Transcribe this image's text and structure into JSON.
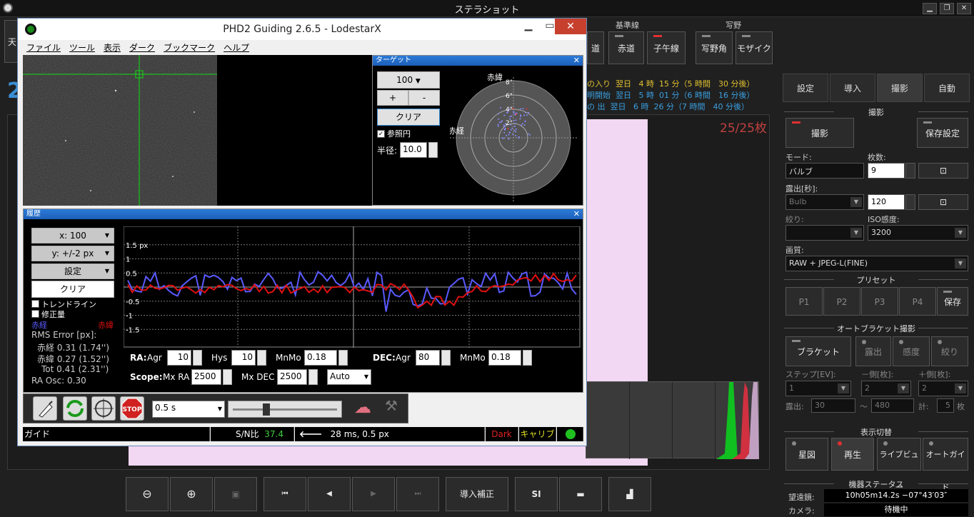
{
  "app_title": "ステラショット",
  "toolbar_groups": {
    "baseline": "基準線",
    "field": "写野"
  },
  "top_buttons": {
    "left_cut": "天",
    "road": "道",
    "equator": "赤道",
    "meridian": "子午線",
    "field_angle": "写野角",
    "mosaic": "モザイク"
  },
  "left_big_number": "2",
  "events": [
    {
      "name": "の入り",
      "day": "翌日",
      "h": "4 時",
      "m": "15 分",
      "rel": "5 時間　30 分後"
    },
    {
      "name": "明開始",
      "day": "翌日",
      "h": "5 時",
      "m": "01 分",
      "rel": "6 時間　16 分後"
    },
    {
      "name": "の 出",
      "day": "翌日",
      "h": "6 時",
      "m": "26 分",
      "rel": "7 時間　40 分後"
    }
  ],
  "frame_count": "25/25枚",
  "tabs": [
    "設定",
    "導入",
    "撮影",
    "自動"
  ],
  "shoot": {
    "section": "撮影",
    "shoot_btn": "撮影",
    "save_settings_btn": "保存設定",
    "mode_label": "モード:",
    "mode_value": "バルブ",
    "count_label": "枚数:",
    "count_value": "9",
    "exposure_label": "露出[秒]:",
    "exposure_mode": "Bulb",
    "exposure_value": "120",
    "aperture_label": "絞り:",
    "iso_label": "ISO感度:",
    "iso_value": "3200",
    "quality_label": "画質:",
    "quality_value": "RAW + JPEG-L(FINE)"
  },
  "preset": {
    "section": "プリセット",
    "items": [
      "P1",
      "P2",
      "P3",
      "P4"
    ],
    "save": "保存"
  },
  "bracket": {
    "section": "オートブラケット撮影",
    "btn": "ブラケット",
    "exposure": "露出",
    "sensitivity": "感度",
    "aperture": "絞り",
    "step_label": "ステップ[EV]:",
    "minus_label": "－側[枚]:",
    "plus_label": "＋側[枚]:",
    "step_value": "1",
    "minus_value": "2",
    "plus_value": "2",
    "exp_label": "露出:",
    "exp_from": "30",
    "tilde": "～",
    "exp_to": "480",
    "total_label": "計:",
    "total_value": "5",
    "total_unit": "枚"
  },
  "display_switch": {
    "section": "表示切替",
    "items": [
      "星図",
      "再生",
      "ライブビュー",
      "オートガイド"
    ]
  },
  "device_status": {
    "section": "機器ステータス",
    "scope_label": "望遠鏡:",
    "scope_value": "10h05m14.2s −07°43′03″",
    "camera_label": "カメラ:",
    "camera_value": "待機中"
  },
  "bottom_toolbar": {
    "calibrate": "導入補正",
    "si": "SI"
  },
  "phd": {
    "title": "PHD2 Guiding 2.6.5 - LodestarX",
    "menu": [
      "ファイル",
      "ツール",
      "表示",
      "ダーク",
      "ブックマーク",
      "ヘルプ"
    ],
    "target": {
      "title": "ターゲット",
      "zoom": "100",
      "plus": "+",
      "minus": "-",
      "clear": "クリア",
      "ref_circle": "参照円",
      "radius_label": "半径:",
      "radius_value": "10.0",
      "dec_label": "赤緯",
      "ra_label": "赤経",
      "rings": [
        "8\"",
        "6\"",
        "4\"",
        "2\""
      ]
    },
    "history": {
      "title": "履歴",
      "x_scale": "x: 100",
      "y_scale": "y: +/-2 px",
      "settings": "設定",
      "clear": "クリア",
      "trendline": "トレンドライン",
      "correction": "修正量",
      "ra_legend": "赤経",
      "dec_legend": "赤緯",
      "rms_title": "RMS Error [px]:",
      "rms_ra": "赤経 0.31 (1.74'')",
      "rms_dec": "赤緯 0.27 (1.52'')",
      "rms_tot": "Tot 0.41 (2.31'')",
      "ra_osc": "RA Osc: 0.30",
      "y_labels": [
        "1.5 px",
        "1",
        "0.5",
        "-0.5",
        "-1",
        "-1.5"
      ],
      "ra_label": "RA:",
      "agr_label": "Agr",
      "ra_agr": "10",
      "hys_label": "Hys",
      "ra_hys": "10",
      "mnmo_label": "MnMo",
      "ra_mnmo": "0.18",
      "dec_label": "DEC:",
      "dec_agr": "80",
      "dec_mnmo": "0.18",
      "scope_label": "Scope:",
      "mxra_label": "Mx RA",
      "mxra": "2500",
      "mxdec_label": "Mx DEC",
      "mxdec": "2500",
      "mode": "Auto"
    },
    "exposure": "0.5 s",
    "status": {
      "state": "ガイド",
      "snr_label": "S/N比",
      "snr": "37.4",
      "info": "28 ms, 0.5 px",
      "dark": "Dark",
      "calib": "キャリブ"
    }
  },
  "colors": {
    "ra": "#5a5aff",
    "dec": "#e01010",
    "accent": "#3a8fd6"
  }
}
